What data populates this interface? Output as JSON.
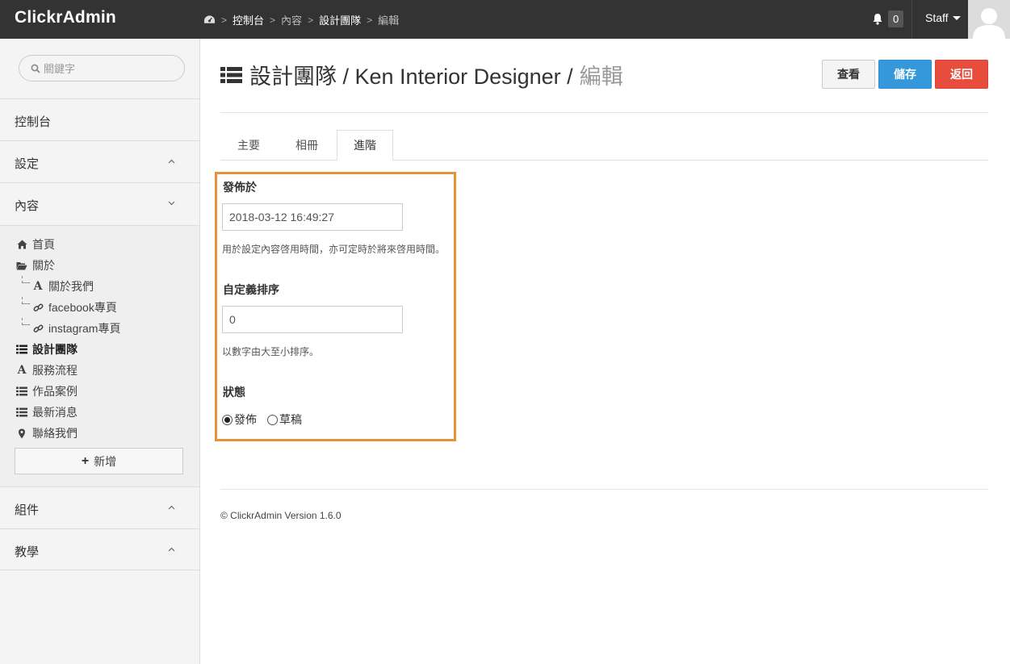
{
  "topbar": {
    "brand": "ClickrAdmin",
    "breadcrumb": [
      "控制台",
      "內容",
      "設計團隊",
      "編輯"
    ],
    "notifications_count": "0",
    "user_label": "Staff"
  },
  "sidebar": {
    "search_placeholder": "關鍵字",
    "sections": {
      "dashboard": "控制台",
      "settings": "設定",
      "content": "內容",
      "components": "組件",
      "tutorials": "教學"
    },
    "items": [
      {
        "label": "首頁",
        "icon": "home-icon"
      },
      {
        "label": "關於",
        "icon": "folder-open-icon"
      },
      {
        "label": "關於我們",
        "icon": "font-icon"
      },
      {
        "label": "facebook專頁",
        "icon": "link-icon"
      },
      {
        "label": "instagram專頁",
        "icon": "link-icon"
      },
      {
        "label": "設計團隊",
        "icon": "list-icon"
      },
      {
        "label": "服務流程",
        "icon": "font-icon"
      },
      {
        "label": "作品案例",
        "icon": "list-icon"
      },
      {
        "label": "最新消息",
        "icon": "list-icon"
      },
      {
        "label": "聯絡我們",
        "icon": "map-marker-icon"
      }
    ],
    "add_label": "新增"
  },
  "main": {
    "title": "設計團隊 / Ken Interior Designer /",
    "title_suffix": "編輯",
    "buttons": {
      "view": "查看",
      "save": "儲存",
      "back": "返回"
    },
    "tabs": [
      "主要",
      "相冊",
      "進階"
    ],
    "active_tab": "進階",
    "form": {
      "publish_label": "發佈於",
      "publish_value": "2018-03-12 16:49:27",
      "publish_help": "用於設定內容啓用時間，亦可定時於將來啓用時間。",
      "order_label": "自定義排序",
      "order_value": "0",
      "order_help": "以數字由大至小排序。",
      "status_label": "狀態",
      "status_options": [
        "發佈",
        "草稿"
      ],
      "status_selected": "發佈"
    }
  },
  "footer": {
    "text": "© ClickrAdmin Version 1.6.0"
  },
  "colors": {
    "topbar": "#333333",
    "save": "#3498db",
    "back": "#e74c3c",
    "highlight": "#e8913b"
  }
}
